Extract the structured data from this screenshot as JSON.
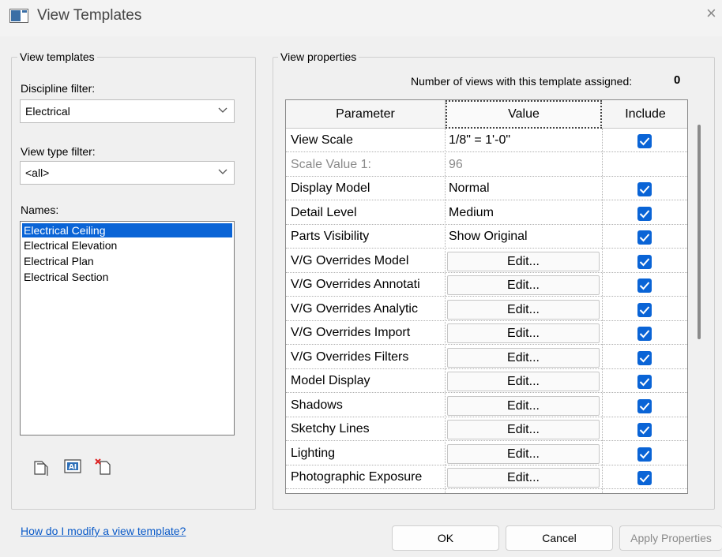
{
  "window": {
    "title": "View Templates",
    "close_glyph": "×"
  },
  "left": {
    "group_title": "View templates",
    "discipline_label": "Discipline filter:",
    "discipline_value": "Electrical",
    "view_type_label": "View type filter:",
    "view_type_value": "<all>",
    "names_label": "Names:",
    "names": [
      "Electrical Ceiling",
      "Electrical Elevation",
      "Electrical Plan",
      "Electrical Section"
    ],
    "selected_name": "Electrical Ceiling",
    "tool_icons": [
      "duplicate-icon",
      "rename-icon",
      "delete-icon"
    ]
  },
  "right": {
    "group_title": "View properties",
    "assigned_label": "Number of views with this template assigned:",
    "assigned_count": "0",
    "columns": {
      "parameter": "Parameter",
      "value": "Value",
      "include": "Include"
    },
    "rows": [
      {
        "param": "View Scale",
        "value": "1/8\" = 1'-0\"",
        "type": "text",
        "include": true
      },
      {
        "param": "Scale Value    1:",
        "value": "96",
        "type": "muted",
        "include": null
      },
      {
        "param": "Display Model",
        "value": "Normal",
        "type": "text",
        "include": true
      },
      {
        "param": "Detail Level",
        "value": "Medium",
        "type": "text",
        "include": true
      },
      {
        "param": "Parts Visibility",
        "value": "Show Original",
        "type": "text",
        "include": true
      },
      {
        "param": "V/G Overrides Model",
        "value": "Edit...",
        "type": "button",
        "include": true
      },
      {
        "param": "V/G Overrides Annotati",
        "value": "Edit...",
        "type": "button",
        "include": true
      },
      {
        "param": "V/G Overrides Analytic",
        "value": "Edit...",
        "type": "button",
        "include": true
      },
      {
        "param": "V/G Overrides Import",
        "value": "Edit...",
        "type": "button",
        "include": true
      },
      {
        "param": "V/G Overrides Filters",
        "value": "Edit...",
        "type": "button",
        "include": true
      },
      {
        "param": "Model Display",
        "value": "Edit...",
        "type": "button",
        "include": true
      },
      {
        "param": "Shadows",
        "value": "Edit...",
        "type": "button",
        "include": true
      },
      {
        "param": "Sketchy Lines",
        "value": "Edit...",
        "type": "button",
        "include": true
      },
      {
        "param": "Lighting",
        "value": "Edit...",
        "type": "button",
        "include": true
      },
      {
        "param": "Photographic Exposure",
        "value": "Edit...",
        "type": "button",
        "include": true
      },
      {
        "param": "",
        "value": "",
        "type": "text",
        "include": false
      }
    ]
  },
  "footer": {
    "help_link": "How do I modify a view template?",
    "ok": "OK",
    "cancel": "Cancel",
    "apply": "Apply Properties"
  },
  "colors": {
    "accent": "#0a64d6",
    "link": "#0a5ac8",
    "muted": "#8a8a8a"
  }
}
